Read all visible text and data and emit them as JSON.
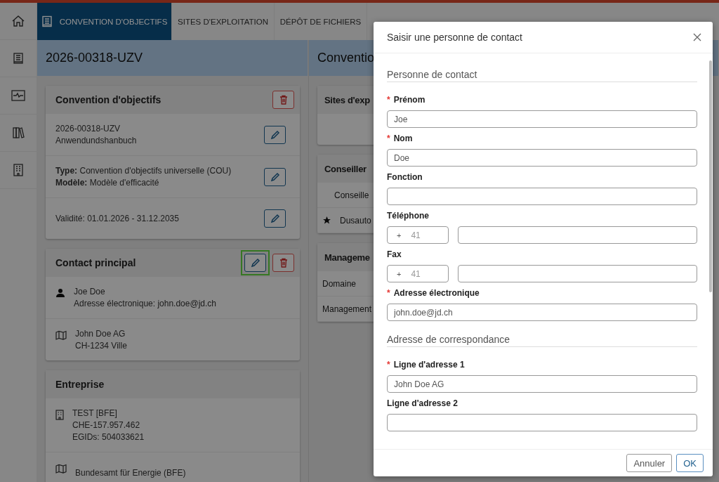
{
  "tabs": [
    {
      "label": "CONVENTION D'OBJECTIFS",
      "selected": true
    },
    {
      "label": "SITES D'EXPLOITATION",
      "selected": false
    },
    {
      "label": "DÉPÔT DE FICHIERS",
      "selected": false
    }
  ],
  "header": {
    "title": "2026-00318-UZV",
    "right_title": "Conventio"
  },
  "left_cards": [
    {
      "title": "Convention d'objectifs",
      "header_buttons": [
        {
          "kind": "delete"
        }
      ],
      "rows": [
        {
          "kind": "editable",
          "lines": [
            "2026-00318-UZV",
            "Anwendundshanbuch"
          ]
        },
        {
          "kind": "editable",
          "lines": [
            "**Type:** Convention d'objectifs universelle (COU)",
            "**Modèle:** Modèle d'efficacité"
          ]
        },
        {
          "kind": "editable",
          "lines": [
            "Validité: 01.01.2026 - 31.12.2035"
          ]
        }
      ]
    },
    {
      "title": "Contact principal",
      "header_buttons": [
        {
          "kind": "edit",
          "highlighted": true
        },
        {
          "kind": "delete"
        }
      ],
      "rows": [
        {
          "kind": "person",
          "lines": [
            "Joe Doe",
            "Adresse électronique: john.doe@jd.ch"
          ]
        },
        {
          "kind": "address",
          "lines": [
            "John Doe AG",
            "CH-1234 Ville"
          ]
        }
      ]
    },
    {
      "title": "Entreprise",
      "rows": [
        {
          "kind": "company",
          "lines": [
            "TEST [BFE]",
            "CHE-157.957.462",
            "EGIDs: 504033621"
          ]
        },
        {
          "kind": "address",
          "lines": [
            "Bundesamt für Energie (BFE)"
          ]
        }
      ]
    }
  ],
  "right_cards": [
    {
      "title": "Sites d'exp"
    },
    {
      "title": "Conseiller",
      "rows": [
        {
          "kind": "subheader",
          "text": "Conseille"
        },
        {
          "kind": "starred",
          "text": "Dusauto"
        }
      ]
    },
    {
      "title": "Manageme",
      "rows": [
        {
          "kind": "plain",
          "text": "Domaine"
        },
        {
          "kind": "plain",
          "text": "Management"
        }
      ]
    }
  ],
  "dialog": {
    "title": "Saisir une personne de contact",
    "sections": [
      {
        "heading": "Personne de contact",
        "fields": [
          {
            "kind": "text",
            "label": "Prénom",
            "required_mark": "*",
            "value": "Joe"
          },
          {
            "kind": "text",
            "label": "Nom",
            "required_mark": "*",
            "value": "Doe"
          },
          {
            "kind": "text",
            "label": "Fonction"
          },
          {
            "kind": "phone",
            "label": "Téléphone",
            "prefix": "+",
            "placeholder": "41"
          },
          {
            "kind": "phone",
            "label": "Fax",
            "prefix": "+",
            "placeholder": "41"
          },
          {
            "kind": "text",
            "label": "Adresse électronique",
            "required_mark": "*",
            "value": "john.doe@jd.ch"
          }
        ]
      },
      {
        "heading": "Adresse de correspondance",
        "fields": [
          {
            "kind": "text",
            "label": "Ligne d'adresse 1",
            "required_mark": "*",
            "value": "John Doe AG"
          },
          {
            "kind": "text",
            "label": "Ligne d'adresse 2"
          }
        ]
      }
    ],
    "buttons": [
      {
        "label": "Annuler",
        "kind": "secondary"
      },
      {
        "label": "OK",
        "kind": "primary"
      }
    ]
  }
}
